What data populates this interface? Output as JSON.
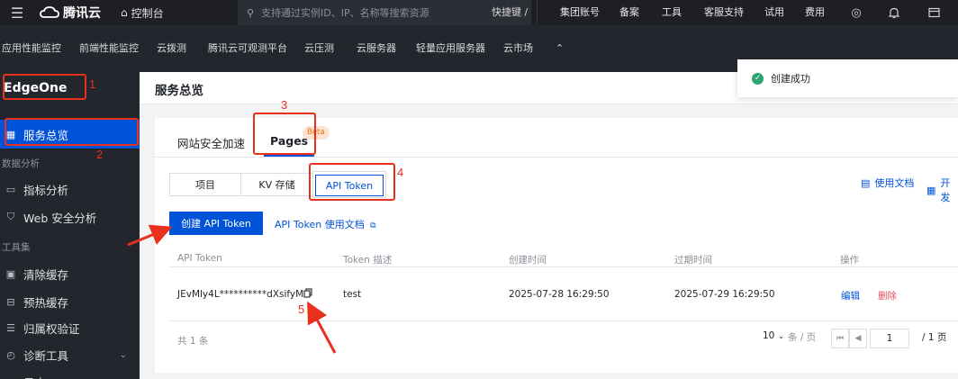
{
  "topbar": {
    "brand": "腾讯云",
    "console": "控制台",
    "search_placeholder": "支持通过实例ID、IP、名称等搜索资源",
    "shortcut": "快捷键 /",
    "nav": [
      "集团账号",
      "备案",
      "工具",
      "客服支持",
      "试用",
      "费用"
    ]
  },
  "product_bar": [
    "应用性能监控",
    "前端性能监控",
    "云拨测",
    "腾讯云可观测平台",
    "云压测",
    "云服务器",
    "轻量应用服务器",
    "云市场"
  ],
  "sidebar": {
    "product": "EdgeOne",
    "overview": "服务总览",
    "group_analysis": "数据分析",
    "metric": "指标分析",
    "web_security": "Web 安全分析",
    "group_tools": "工具集",
    "purge": "清除缓存",
    "prefetch": "预热缓存",
    "ownership": "归属权验证",
    "diagnose": "诊断工具",
    "logs": "日志"
  },
  "page": {
    "title": "服务总览"
  },
  "tabs": {
    "site": "网站安全加速",
    "pages": "Pages",
    "beta": "Beta"
  },
  "segments": {
    "project": "项目",
    "kv": "KV 存储",
    "token": "API Token"
  },
  "right_links": {
    "docs": "使用文档",
    "dev": "开发"
  },
  "create_button": "创建 API Token",
  "token_doc_link": "API Token 使用文档",
  "table": {
    "headers": [
      "API Token",
      "Token 描述",
      "创建时间",
      "过期时间",
      "操作"
    ],
    "rows": [
      {
        "token": "JEvMly4L**********dXsifyM=",
        "desc": "test",
        "created": "2025-07-28 16:29:50",
        "expires": "2025-07-29 16:29:50",
        "edit": "编辑",
        "delete": "删除"
      }
    ]
  },
  "pagination": {
    "total": "共 1 条",
    "page_size": "10",
    "per_page": "条 / 页",
    "current": "1",
    "pages": "/ 1 页"
  },
  "toast": "创建成功",
  "annotations": [
    "1",
    "2",
    "3",
    "4",
    "5"
  ]
}
